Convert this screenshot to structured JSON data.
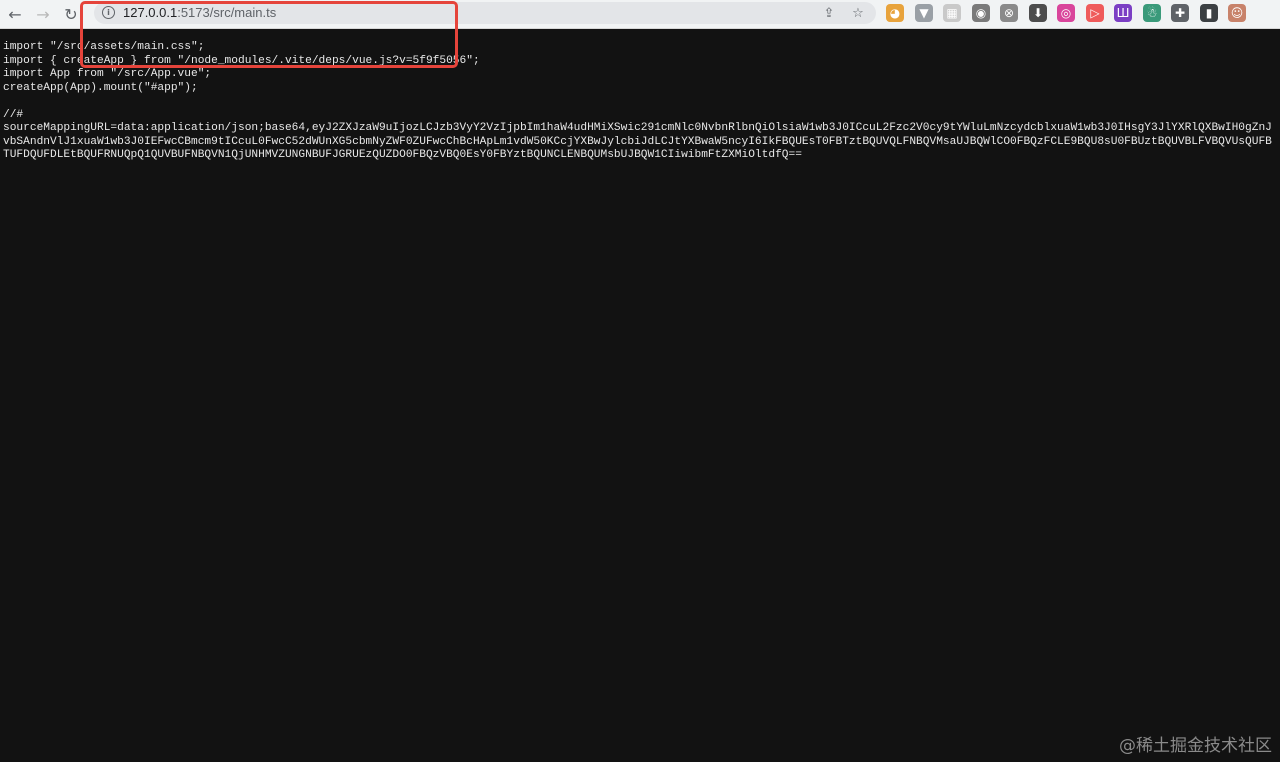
{
  "browser": {
    "url_host": "127.0.0.1",
    "url_path": ":5173/src/main.ts",
    "nav": {
      "back_icon": "←",
      "forward_icon": "→",
      "reload_icon": "↻"
    },
    "omnibox_actions": {
      "share_icon": "⇪",
      "bookmark_icon": "☆"
    },
    "extensions": [
      {
        "name": "ext-1",
        "glyph": "◕",
        "color": "#e8a33c"
      },
      {
        "name": "ext-2",
        "glyph": "▼",
        "color": "#9aa0a6"
      },
      {
        "name": "ext-3",
        "glyph": "▦",
        "color": "#c9c9c9"
      },
      {
        "name": "ext-4",
        "glyph": "◉",
        "color": "#7a7a7a"
      },
      {
        "name": "ext-5",
        "glyph": "⊗",
        "color": "#8a8a8a"
      },
      {
        "name": "ext-6",
        "glyph": "⬇",
        "color": "#4d4d4d"
      },
      {
        "name": "ext-7",
        "glyph": "◎",
        "color": "#d9459b"
      },
      {
        "name": "ext-8",
        "glyph": "▷",
        "color": "#ef5b5b"
      },
      {
        "name": "ext-9",
        "glyph": "Ш",
        "color": "#7b3fc4"
      },
      {
        "name": "ext-10",
        "glyph": "☃",
        "color": "#3a9a7a"
      },
      {
        "name": "ext-11",
        "glyph": "✚",
        "color": "#5f6368"
      },
      {
        "name": "ext-12",
        "glyph": "▮",
        "color": "#3c4043"
      },
      {
        "name": "ext-13",
        "glyph": "☺",
        "color": "#c8826a"
      }
    ]
  },
  "source": {
    "line1": "import \"/src/assets/main.css\";",
    "line2": "import { createApp } from \"/node_modules/.vite/deps/vue.js?v=5f9f5056\";",
    "line3": "import App from \"/src/App.vue\";",
    "line4": "createApp(App).mount(\"#app\");",
    "line5": "",
    "line6": "//#",
    "line7": "sourceMappingURL=data:application/json;base64,eyJ2ZXJzaW9uIjozLCJzb3VyY2VzIjpbIm1haW4udHMiXSwic291cmNlc0NvbnRlbnQiOlsiaW1wb3J0ICcuL2Fzc2V0cy9tYWluLmNzcydcblxuaW1wb3J0IHsgY3JlYXRlQXBwIH0gZnJvbSAndnVlJ1xuaW1wb3J0IEFwcCBmcm9tICcuL0FwcC52dWUnXG5cbmNyZWF0ZUFwcChBcHApLm1vdW50KCcjYXBwJylcbiJdLCJtYXBwaW5ncyI6IkFBQUEsT0FBTztBQUVQLFNBQVMsaUJBQWlCO0FBQzFCLE9BQU8sU0FBUztBQUVBLFVBQVUsQUFBTUFDQUFDLEtBQUFRNUQpQ1QUVBUFNBQVN1QjUNHMVZUNGNBUFJGRUEzQUZDO0FBQzVBQ0EsY0FBYztBQUNCLENBQUMsbUJBQW1CIiwibmFtZXMiOltdfQ=="
  },
  "watermark": "@稀土掘金技术社区"
}
